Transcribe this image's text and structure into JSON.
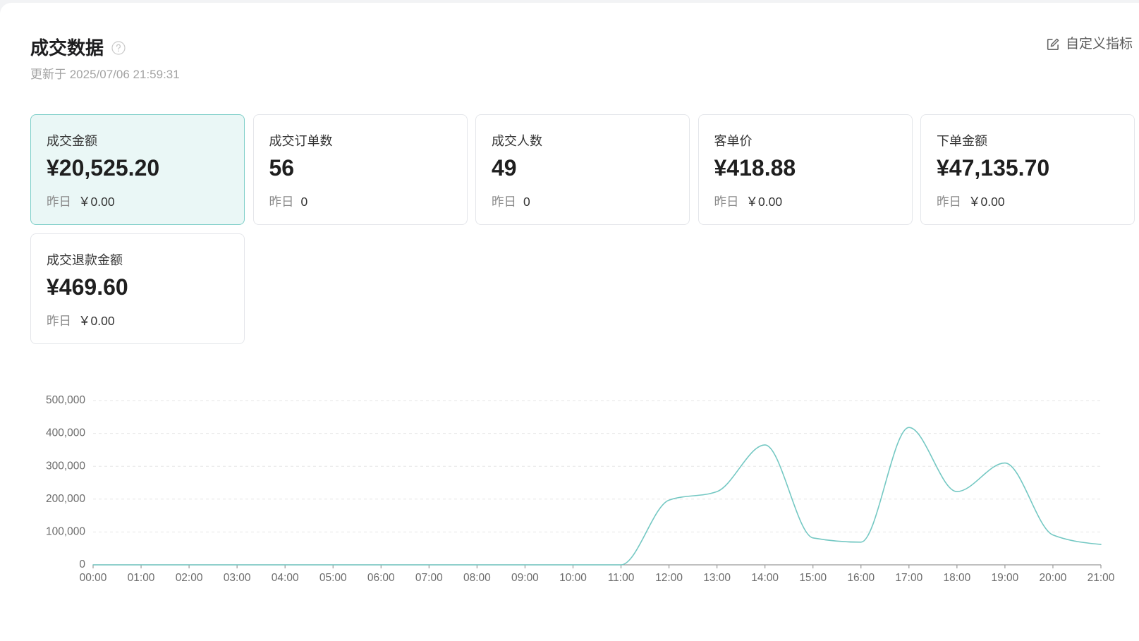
{
  "header": {
    "title": "成交数据",
    "help_icon": "question-circle-icon",
    "updated": "更新于 2025/07/06 21:59:31",
    "customize_icon": "edit-icon",
    "customize_label": "自定义指标"
  },
  "colors": {
    "line": "#74c8c3",
    "selected_bg": "#eaf7f6",
    "selected_border": "#7fcfc9"
  },
  "metrics": [
    {
      "label": "成交金额",
      "value": "¥20,525.20",
      "yesterday_label": "昨日",
      "yesterday_value": "￥0.00",
      "selected": true
    },
    {
      "label": "成交订单数",
      "value": "56",
      "yesterday_label": "昨日",
      "yesterday_value": "0",
      "selected": false
    },
    {
      "label": "成交人数",
      "value": "49",
      "yesterday_label": "昨日",
      "yesterday_value": "0",
      "selected": false
    },
    {
      "label": "客单价",
      "value": "¥418.88",
      "yesterday_label": "昨日",
      "yesterday_value": "￥0.00",
      "selected": false
    },
    {
      "label": "下单金额",
      "value": "¥47,135.70",
      "yesterday_label": "昨日",
      "yesterday_value": "￥0.00",
      "selected": false
    },
    {
      "label": "成交退款金额",
      "value": "¥469.60",
      "yesterday_label": "昨日",
      "yesterday_value": "￥0.00",
      "selected": false
    }
  ],
  "chart_data": {
    "type": "line",
    "title": "",
    "xlabel": "",
    "ylabel": "",
    "x": [
      "00:00",
      "01:00",
      "02:00",
      "03:00",
      "04:00",
      "05:00",
      "06:00",
      "07:00",
      "08:00",
      "09:00",
      "10:00",
      "11:00",
      "12:00",
      "13:00",
      "14:00",
      "15:00",
      "16:00",
      "17:00",
      "18:00",
      "19:00",
      "20:00",
      "21:00"
    ],
    "series": [
      {
        "values": [
          0,
          0,
          0,
          0,
          0,
          0,
          0,
          0,
          0,
          0,
          0,
          0,
          197000,
          223000,
          365000,
          82000,
          69000,
          418000,
          223000,
          310000,
          91000,
          62000
        ]
      }
    ],
    "yticks": [
      "0",
      "100,000",
      "200,000",
      "300,000",
      "400,000",
      "500,000"
    ],
    "ylim": [
      0,
      500000
    ],
    "grid": true,
    "smooth": true,
    "legend": "none"
  }
}
